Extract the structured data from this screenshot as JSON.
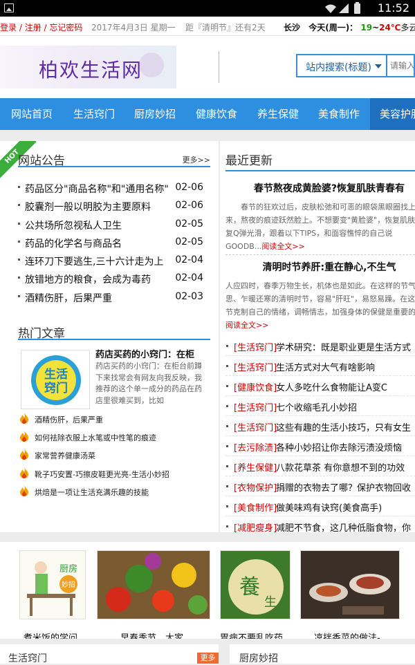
{
  "status_bar": {
    "time": "11:52"
  },
  "topbar": {
    "login": "登录",
    "register": "注册",
    "forgot": "忘记密码",
    "date": "2017年4月3日 星期一",
    "countdown": "距『清明节』还有2天",
    "city": "长沙",
    "today": "今天(周一)：",
    "temp_low": "19",
    "temp_sep": "~",
    "temp_high": "24℃",
    "condition": "多云"
  },
  "header": {
    "logo_text": "柏欢生活网",
    "search_scope": "站内搜索(标题)",
    "search_placeholder": "请输入"
  },
  "nav": {
    "items": [
      {
        "label": "网站首页"
      },
      {
        "label": "生活窍门"
      },
      {
        "label": "厨房妙招"
      },
      {
        "label": "健康饮食"
      },
      {
        "label": "养生保健"
      },
      {
        "label": "美食制作"
      },
      {
        "label": "美容护肤"
      }
    ]
  },
  "notice": {
    "ribbon": "HOT",
    "title": "网站公告",
    "more": "更多>>",
    "items": [
      {
        "title": "药品区分\"商品名称\"和\"通用名称\"",
        "date": "02-06"
      },
      {
        "title": "胶囊剂一般以明胶为主要原料",
        "date": "02-06"
      },
      {
        "title": "公共场所忽视私人卫生",
        "date": "02-05"
      },
      {
        "title": "药品的化学名与商品名",
        "date": "02-05"
      },
      {
        "title": "连环刀下要逃生,三十六计走为上",
        "date": "02-04"
      },
      {
        "title": "放错地方的粮食，会成为毒药",
        "date": "02-04"
      },
      {
        "title": "酒精伤肝，后果严重",
        "date": "02-03"
      }
    ]
  },
  "hot": {
    "title": "热门文章",
    "feature": {
      "thumb_text_1": "生活",
      "thumb_text_2": "窍门",
      "title": "药店买药的小窍门：在柜",
      "desc": "药店买药的小窍门：在柜台前蹲下来找常会有网友向我反映，我推荐的这个单一成分的药品在药店里很难买到，比如"
    },
    "items": [
      {
        "title": "酒精伤肝，后果严重"
      },
      {
        "title": "如何祛除衣服上水笔或中性笔的痕迹"
      },
      {
        "title": "家常营养健康汤菜"
      },
      {
        "title": "靴子巧安置-巧擦皮鞋更光亮-生活小妙招"
      },
      {
        "title": "烘焙是一项让生活充满乐趣的技能"
      }
    ]
  },
  "recent": {
    "title": "最近更新",
    "articles": [
      {
        "title": "春节熬夜成黄脸婆?恢复肌肤青春有",
        "body": "春节的狂欢过后，皮肤松弛和可恶的眼袋黑眼圈找上门来，熬夜的痕迹跃然脸上。不想要变\"黄脸婆\"，恢复肌肤恢复Q弹光滑，跟着以下TIPS，和面容憔悴的自己说GOODB...",
        "readmore": "阅读全文>>"
      },
      {
        "title": "清明时节养肝:重在静心,不生气",
        "body": "人应四时，春季万物生长，机体也是如此。在这样的节气思、乍暖还寒的清明时节，容易\"肝旺\"，易怒易躁。在这个节克制自己的情绪，调畅情志，加强身体的保健是重要的...",
        "readmore": "阅读全文>>"
      }
    ],
    "updates": [
      {
        "category": "[生活窍门]",
        "title": "学术研究：既是职业更是生活方式"
      },
      {
        "category": "[生活窍门]",
        "title": "生活方式对大气有啥影响"
      },
      {
        "category": "[健康饮食]",
        "title": "女人多吃什么食物能让A变C"
      },
      {
        "category": "[生活窍门]",
        "title": "七个收缩毛孔小妙招"
      },
      {
        "category": "[生活窍门]",
        "title": "这些有趣的生活小技巧，只有女生"
      },
      {
        "category": "[去污除渍]",
        "title": "各种小妙招让你去除污渍没烦恼"
      },
      {
        "category": "[养生保健]",
        "title": "八款花草茶 有你意想不到的功效"
      },
      {
        "category": "[衣物保护]",
        "title": "捐赠的衣物去了哪？保护衣物回收"
      },
      {
        "category": "[美食制作]",
        "title": "做美味鸡有诀窍(美食高手)"
      },
      {
        "category": "[减肥瘦身]",
        "title": "减肥不节食，这几种低脂食物，你"
      }
    ]
  },
  "gallery": {
    "items": [
      {
        "caption": "煮米饭的学问",
        "img_label_1": "厨房",
        "img_label_2": "妙招"
      },
      {
        "caption": "早春季节，大家"
      },
      {
        "caption": "胃病不要乱吃药,",
        "img_label_1": "養",
        "img_label_2": "生"
      },
      {
        "caption": "凉拌香菜的做法-"
      }
    ]
  },
  "bottom": {
    "left_title": "生活窍门",
    "left_more": "更多",
    "right_title": "厨房妙招"
  },
  "colors": {
    "nav_bg": "#2e8fe1",
    "nav_active_bg": "#1f6fc0",
    "accent_red": "#d10000",
    "temp_low": "#14a000",
    "more_badge": "#f16a2b",
    "hot_ribbon": "#3cae3c"
  }
}
